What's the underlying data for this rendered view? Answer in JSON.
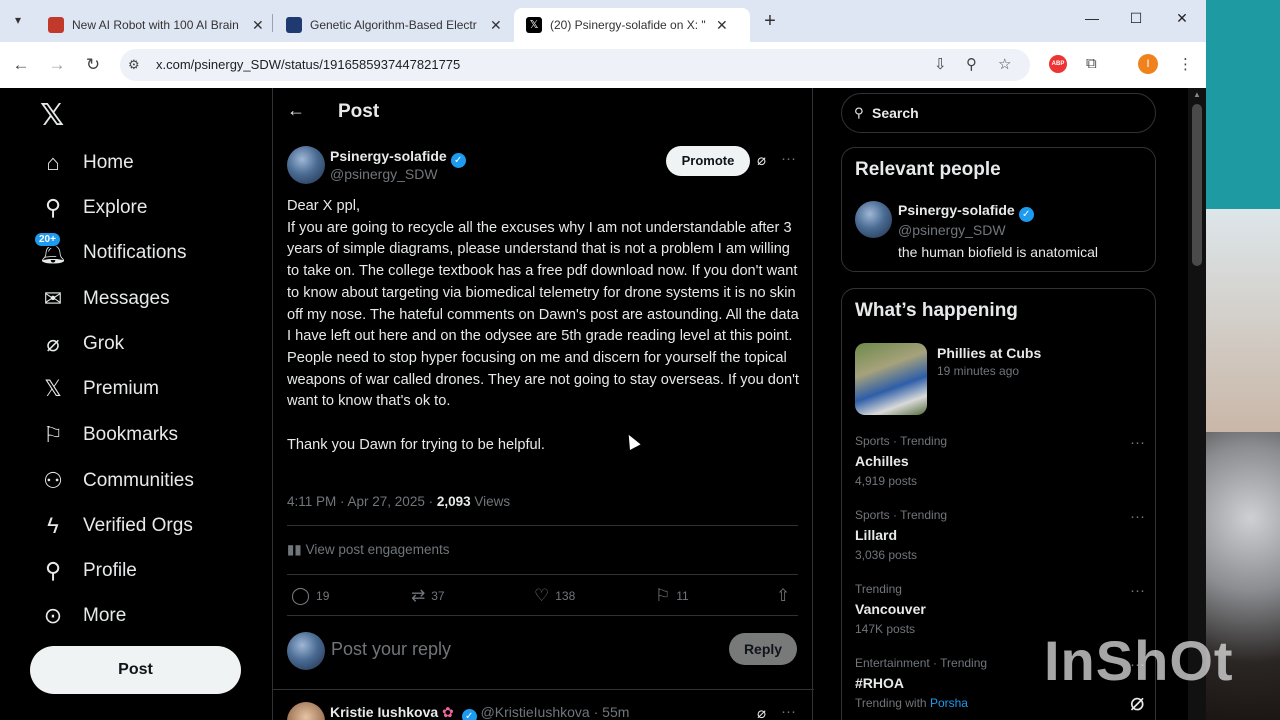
{
  "browser": {
    "tabs": [
      {
        "title": "New AI Robot with 100 AI Brain"
      },
      {
        "title": "Genetic Algorithm-Based Electr"
      },
      {
        "title": "(20) Psinergy-solafide on X: \"De"
      }
    ],
    "url": "x.com/psinergy_SDW/status/1916585937447821775",
    "profile_initial": "I",
    "abp_label": "ABP"
  },
  "nav": {
    "items": [
      {
        "label": "Home",
        "icon": "home-icon"
      },
      {
        "label": "Explore",
        "icon": "search-icon"
      },
      {
        "label": "Notifications",
        "icon": "bell-icon",
        "badge": "20+"
      },
      {
        "label": "Messages",
        "icon": "mail-icon"
      },
      {
        "label": "Grok",
        "icon": "grok-icon"
      },
      {
        "label": "Premium",
        "icon": "x-logo-icon"
      },
      {
        "label": "Bookmarks",
        "icon": "bookmark-icon"
      },
      {
        "label": "Communities",
        "icon": "communities-icon"
      },
      {
        "label": "Verified Orgs",
        "icon": "lightning-icon"
      },
      {
        "label": "Profile",
        "icon": "person-icon"
      },
      {
        "label": "More",
        "icon": "more-circle-icon"
      }
    ],
    "post_button": "Post"
  },
  "main": {
    "title": "Post",
    "author": {
      "name": "Psinergy-solafide",
      "handle": "@psinergy_SDW"
    },
    "promote": "Promote",
    "body": "Dear X ppl,\nIf you are going to recycle all the excuses why I am not understandable after 3 years of simple diagrams, please understand that is not a problem I am willing to take on.  The college textbook has a free pdf download now.  If you don't want to know about targeting via biomedical telemetry for drone systems it is no skin off my nose.  The hateful comments on Dawn's post are astounding.  All the data I have left out here and on the odysee are 5th grade reading level at this point.  People need to stop hyper focusing on me and discern for yourself the topical weapons of war called drones.  They are not going to stay overseas.  If you don't want to know that's ok to.\n\nThank you Dawn for trying to be helpful.",
    "timestamp": "4:11 PM · Apr 27, 2025 · ",
    "views_count": "2,093",
    "views_label": " Views",
    "engagements": "View post engagements",
    "actions": {
      "replies": "19",
      "reposts": "37",
      "likes": "138",
      "bookmarks": "11"
    },
    "reply_placeholder": "Post your reply",
    "reply_button": "Reply",
    "comment": {
      "name": "Kristie Iushkova",
      "handle": "@KristieIushkova",
      "time": "55m"
    }
  },
  "sidebar": {
    "search_placeholder": "Search",
    "relevant_title": "Relevant people",
    "relevant": {
      "name": "Psinergy-solafide",
      "handle": "@psinergy_SDW",
      "bio": "the human biofield is anatomical"
    },
    "happening_title": "What’s happening",
    "featured": {
      "title": "Phillies at Cubs",
      "time": "19 minutes ago"
    },
    "trends": [
      {
        "context": "Sports · Trending",
        "name": "Achilles",
        "count": "4,919 posts"
      },
      {
        "context": "Sports · Trending",
        "name": "Lillard",
        "count": "3,036 posts"
      },
      {
        "context": "Trending",
        "name": "Vancouver",
        "count": "147K posts"
      },
      {
        "context": "Entertainment · Trending",
        "name": "#RHOA",
        "count_prefix": "Trending with ",
        "count_link": "Porsha"
      }
    ]
  },
  "watermark": "InShOt"
}
